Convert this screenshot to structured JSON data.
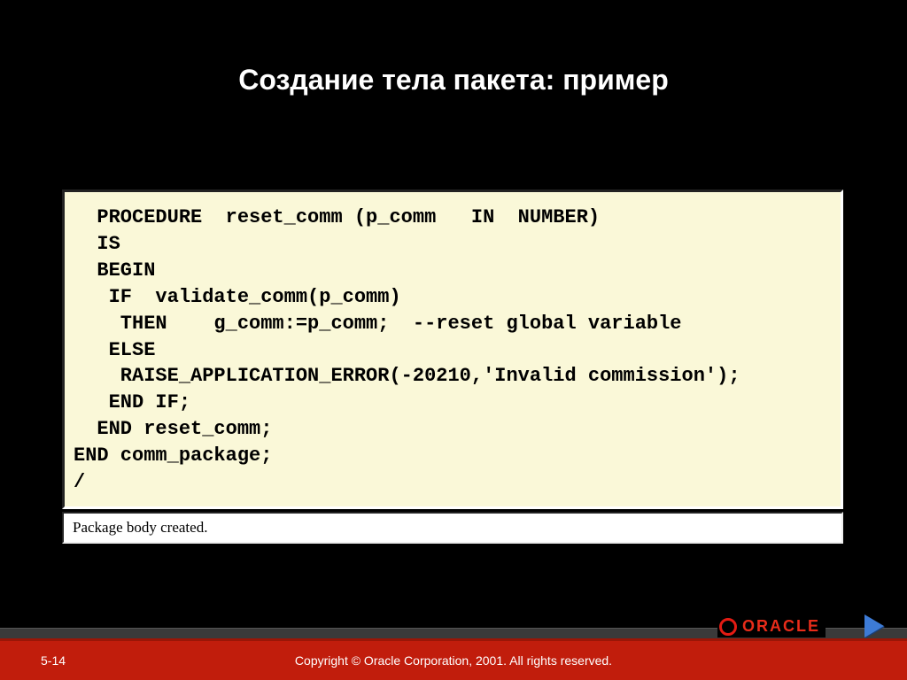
{
  "title": "Создание тела пакета: пример",
  "code": "  PROCEDURE  reset_comm (p_comm   IN  NUMBER)\n  IS\n  BEGIN\n   IF  validate_comm(p_comm)\n    THEN    g_comm:=p_comm;  --reset global variable\n   ELSE\n    RAISE_APPLICATION_ERROR(-20210,'Invalid commission');\n   END IF;\n  END reset_comm;\nEND comm_package;\n/",
  "output": "Package body created.",
  "page_number": "5-14",
  "copyright": "Copyright © Oracle Corporation, 2001. All rights reserved.",
  "logo_text": "ORACLE"
}
